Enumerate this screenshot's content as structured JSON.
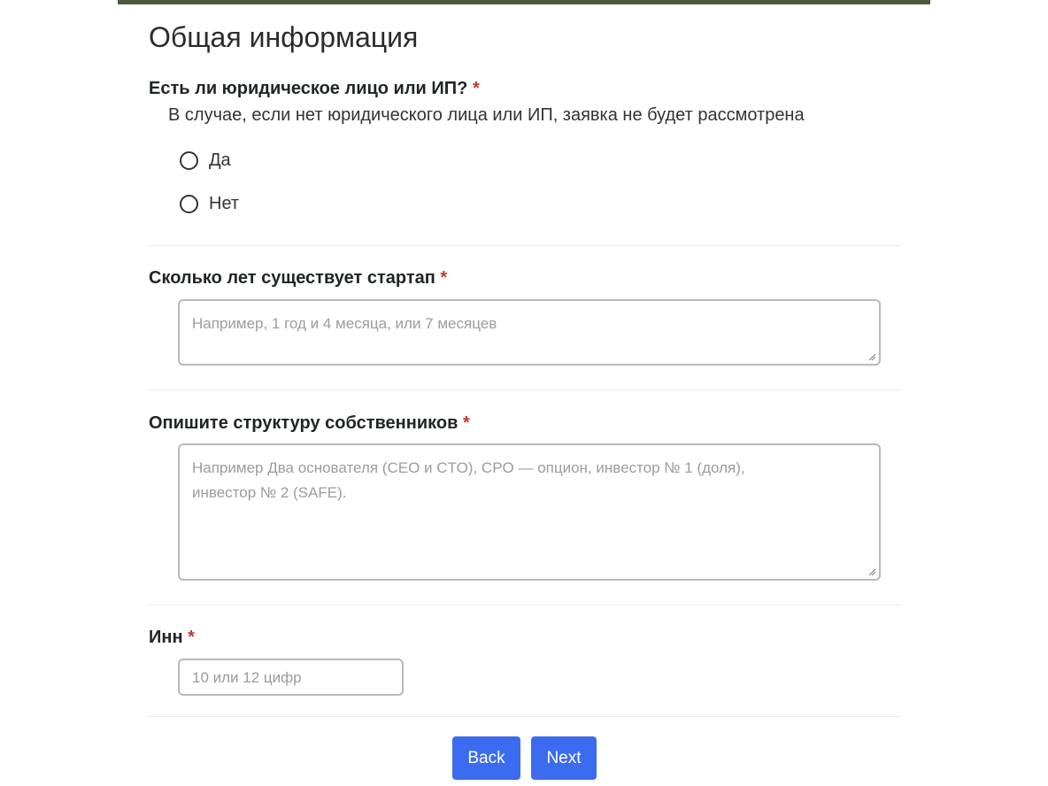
{
  "form": {
    "title": "Общая информация",
    "q1": {
      "label": "Есть ли юридическое лицо или ИП?",
      "required_mark": "*",
      "hint": "В случае, если нет юридического лица или ИП, заявка не будет рассмотрена",
      "options": [
        "Да",
        "Нет"
      ]
    },
    "q2": {
      "label": "Сколько лет существует стартап",
      "required_mark": "*",
      "placeholder": "Например, 1 год и 4 месяца, или 7 месяцев"
    },
    "q3": {
      "label": "Опишите структуру собственников",
      "required_mark": "*",
      "placeholder_line1": "Например  Два основателя (CEO и CTO),  CPO — опцион,   инвестор № 1 (доля),",
      "placeholder_line2": "инвестор № 2 (SAFE)."
    },
    "q4": {
      "label": "Инн",
      "required_mark": "*",
      "placeholder": "10 или 12 цифр"
    }
  },
  "buttons": {
    "back": "Back",
    "next": "Next"
  },
  "colors": {
    "top_bar": "#4a5a3a",
    "accent": "#3b6cf0",
    "required": "#c0392b"
  }
}
